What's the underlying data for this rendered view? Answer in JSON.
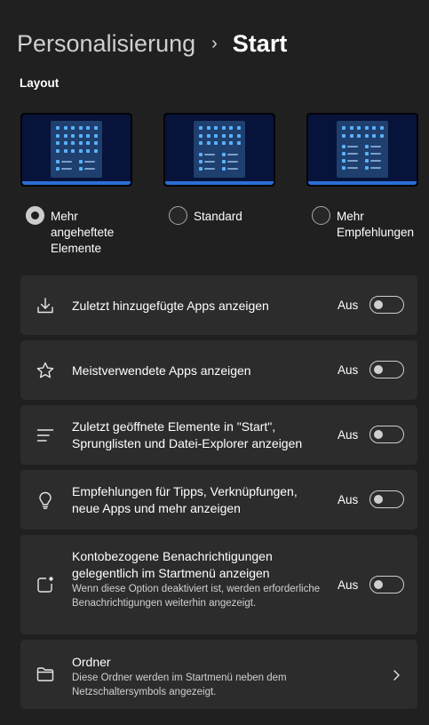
{
  "breadcrumb": {
    "parent": "Personalisierung",
    "separator": "›",
    "current": "Start"
  },
  "layout_section": {
    "label": "Layout",
    "options": [
      {
        "label": "Mehr\nangeheftete\nElemente",
        "selected": true
      },
      {
        "label": "Standard",
        "selected": false
      },
      {
        "label": "Mehr\nEmpfehlungen",
        "selected": false
      }
    ]
  },
  "settings": [
    {
      "icon": "download-icon",
      "title": "Zuletzt hinzugefügte Apps anzeigen",
      "state": "Aus",
      "on": false
    },
    {
      "icon": "star-icon",
      "title": "Meistverwendete Apps anzeigen",
      "state": "Aus",
      "on": false
    },
    {
      "icon": "list-icon",
      "title": "Zuletzt geöffnete Elemente in \"Start\", Sprunglisten und Datei-Explorer anzeigen",
      "state": "Aus",
      "on": false
    },
    {
      "icon": "lightbulb-icon",
      "title": "Empfehlungen für Tipps, Verknüpfungen, neue Apps und mehr anzeigen",
      "state": "Aus",
      "on": false
    },
    {
      "icon": "notification-icon",
      "title": "Kontobezogene Benachrichtigungen gelegentlich im Startmenü anzeigen",
      "description": "Wenn diese Option deaktiviert ist, werden erforderliche Benachrichtigungen weiterhin angezeigt.",
      "state": "Aus",
      "on": false
    },
    {
      "icon": "folder-icon",
      "title": "Ordner",
      "description": "Diese Ordner werden im Startmenü neben dem Netzschaltersymbols angezeigt.",
      "chevron": "chevron-right-icon"
    }
  ]
}
